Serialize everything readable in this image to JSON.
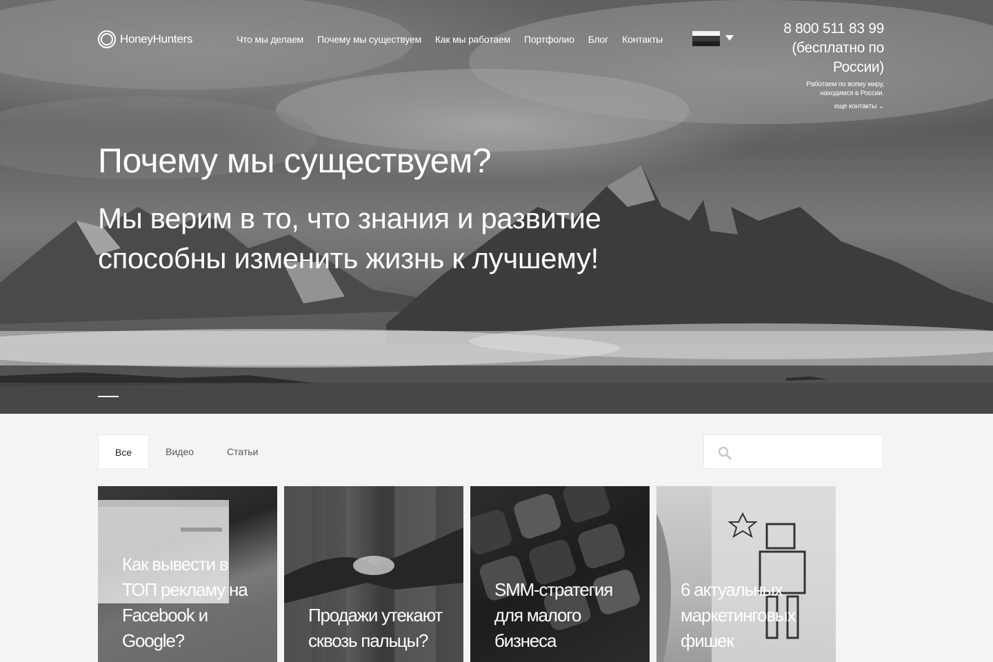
{
  "header": {
    "brand": "HoneyHunters",
    "nav": [
      "Что мы делаем",
      "Почему мы существуем",
      "Как мы работаем",
      "Портфолио",
      "Блог",
      "Контакты"
    ],
    "phone": "8 800 511 83 99",
    "phone_note_1": "(бесплатно по",
    "phone_note_2": "России)",
    "work_note_1": "Работаем по всему миру,",
    "work_note_2": "находимся в России.",
    "more_contacts": "еще контакты ⌄"
  },
  "hero": {
    "title": "Почему мы существуем?",
    "subtitle": "Мы верим в то, что знания и развитие способны изменить жизнь к лучшему!"
  },
  "filters": {
    "tabs": [
      "Все",
      "Видео",
      "Статьи"
    ],
    "active": "Все"
  },
  "search": {
    "placeholder": "",
    "icon": "search-icon"
  },
  "cards": [
    {
      "title": "Как вывести в ТОП рекламу на Facebook и Google?",
      "image": "laptop-google"
    },
    {
      "title": "Продажи утекают сквозь пальцы?",
      "image": "handshake"
    },
    {
      "title": "SMM-стратегия для малого бизнеса",
      "image": "social-apps"
    },
    {
      "title": "6 актуальных маркетинговых фишек",
      "image": "robot-drawing"
    }
  ],
  "colors": {
    "page_bg": "#f4f4f4",
    "text_light": "#ffffff",
    "tab_text": "#555555"
  }
}
